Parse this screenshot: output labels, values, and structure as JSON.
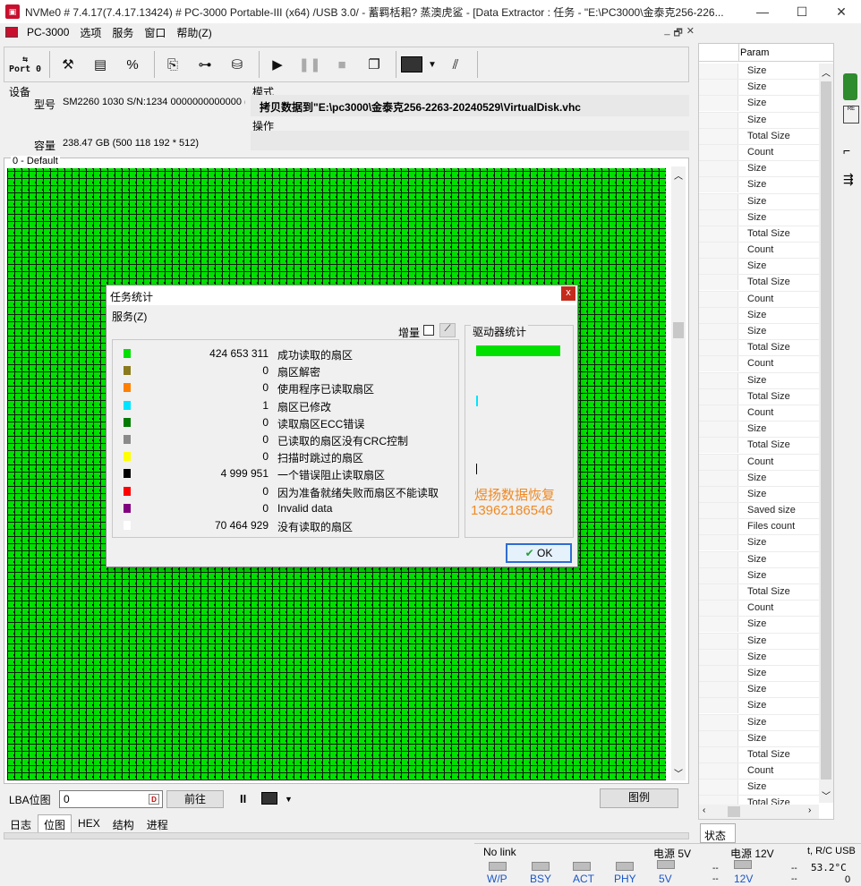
{
  "window": {
    "title": "NVMe0 # 7.4.17(7.4.17.13424) # PC-3000 Portable-III (x64) /USB 3.0/ - 蓄羁栝耜? 蒸澳虎鲨   - [Data Extractor : 任务 - \"E:\\PC3000\\金泰克256-226...",
    "min": "—",
    "max": "☐",
    "close": "✕"
  },
  "menu": {
    "items": [
      "PC-3000",
      "选项",
      "服务",
      "窗口",
      "帮助(Z)"
    ],
    "mdi_buttons": [
      "_",
      "🗗",
      "✕"
    ]
  },
  "toolbar": {
    "port_label": "Port 0",
    "icons": [
      "port-icon",
      "tools-icon",
      "chip-icon",
      "percent-icon",
      "copy-icon",
      "binoculars-icon",
      "disk-icon",
      "play-icon",
      "pause-icon",
      "stop-icon",
      "window-icon",
      "image-icon",
      "dropdown-icon",
      "run-icon"
    ]
  },
  "device": {
    "section": "设备",
    "model_label": "型号",
    "model_value": "SM2260 1030 S/N:1234   0000000000000 (",
    "capacity_label": "容量",
    "capacity_value": "238.47 GB (500 118 192 * 512)"
  },
  "mode": {
    "section": "模式",
    "value": "拷贝数据到\"E:\\pc3000\\金泰克256-2263-20240529\\VirtualDisk.vhc",
    "operation": "操作"
  },
  "map": {
    "title": "0 - Default",
    "block_color": "#00e000"
  },
  "controls": {
    "lba_label": "LBA位图",
    "lba_value": "0",
    "goto_button": "前往",
    "pause": "II",
    "legend_button": "图例"
  },
  "tabs": [
    "日志",
    "位图",
    "HEX",
    "结构",
    "进程"
  ],
  "active_tab": "位图",
  "right_panel": {
    "header": "Param",
    "params": [
      "Size",
      "Size",
      "Size",
      "Size",
      "Total Size",
      "Count",
      "Size",
      "Size",
      "Size",
      "Size",
      "Total Size",
      "Count",
      "Size",
      "Total Size",
      "Count",
      "Size",
      "Size",
      "Total Size",
      "Count",
      "Size",
      "Total Size",
      "Count",
      "Size",
      "Total Size",
      "Count",
      "Size",
      "Size",
      "Saved size",
      "Files count",
      "Size",
      "Size",
      "Size",
      "Total Size",
      "Count",
      "Size",
      "Size",
      "Size",
      "Size",
      "Size",
      "Size",
      "Size",
      "Size",
      "Total Size",
      "Count",
      "Size",
      "Total Size"
    ],
    "status_tab": "状态"
  },
  "statusbar": {
    "link": "No link",
    "leds": [
      "W/P",
      "BSY",
      "ACT",
      "PHY"
    ],
    "power5_label": "电源 5V",
    "power5_led": "5V",
    "power12_label": "电源 12V",
    "power12_led": "12V",
    "dashes": "--",
    "temp_label": "t, R/C USB",
    "temp_value": "53.2°C",
    "zero": "0"
  },
  "dialog": {
    "title": "任务统计",
    "close": "x",
    "menu": "服务(Z)",
    "increment_label": "增量",
    "drive_stats_label": "驱动器统计",
    "ok": "OK",
    "rows": [
      {
        "color": "#00e000",
        "value": "424 653 311",
        "text": "成功读取的扇区"
      },
      {
        "color": "#8a7a1c",
        "value": "0",
        "text": "扇区解密"
      },
      {
        "color": "#ff8000",
        "value": "0",
        "text": "使用程序已读取扇区"
      },
      {
        "color": "#00e5ff",
        "value": "1",
        "text": "扇区已修改"
      },
      {
        "color": "#007a00",
        "value": "0",
        "text": "读取扇区ECC错误"
      },
      {
        "color": "#8a8a8a",
        "value": "0",
        "text": "已读取的扇区没有CRC控制"
      },
      {
        "color": "#ffff00",
        "value": "0",
        "text": "扫描时跳过的扇区"
      },
      {
        "color": "#000000",
        "value": "4 999 951",
        "text": "一个错误阻止读取扇区"
      },
      {
        "color": "#ff0000",
        "value": "0",
        "text": "因为准备就绪失败而扇区不能读取"
      },
      {
        "color": "#800080",
        "value": "0",
        "text": "Invalid data"
      },
      {
        "color": "#ffffff",
        "value": "70 464 929",
        "text": "没有读取的扇区"
      }
    ],
    "watermark_name": "煜扬数据恢复",
    "watermark_phone": "13962186546"
  }
}
